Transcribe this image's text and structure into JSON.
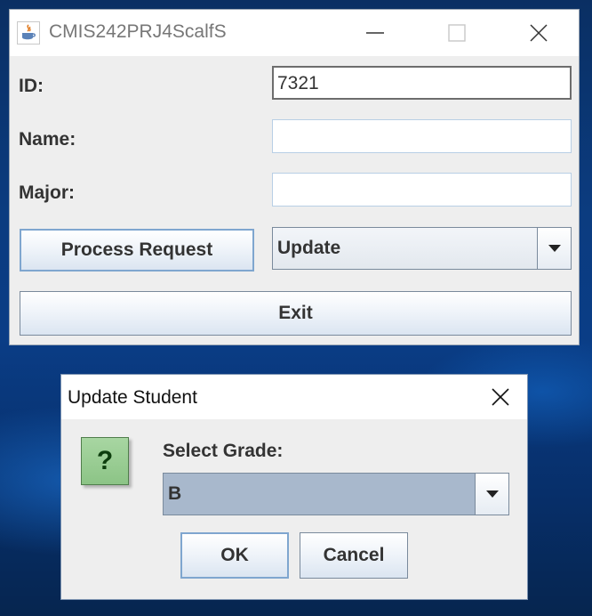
{
  "main_window": {
    "title": "CMIS242PRJ4ScalfS",
    "labels": {
      "id": "ID:",
      "name": "Name:",
      "major": "Major:"
    },
    "fields": {
      "id_value": "7321",
      "name_value": "",
      "major_value": ""
    },
    "process_button": "Process Request",
    "action_select": {
      "selected": "Update"
    },
    "exit_button": "Exit"
  },
  "dialog": {
    "title": "Update Student",
    "prompt": "Select Grade:",
    "grade_select": {
      "selected": "B"
    },
    "ok_button": "OK",
    "cancel_button": "Cancel"
  }
}
